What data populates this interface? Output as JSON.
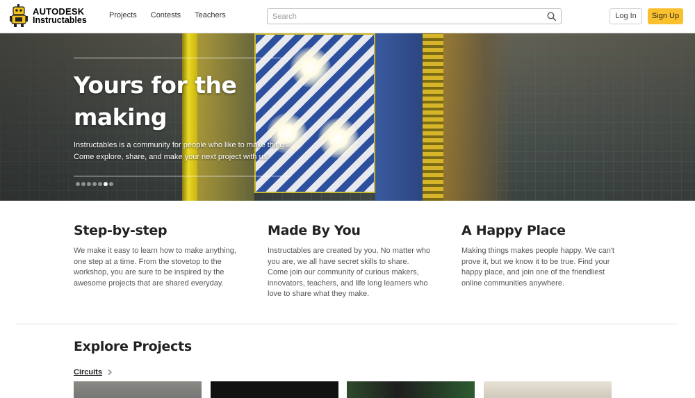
{
  "header": {
    "logo": {
      "brand": "AUTODESK",
      "product": "Instructables"
    },
    "nav": [
      "Projects",
      "Contests",
      "Teachers"
    ],
    "search": {
      "placeholder": "Search"
    },
    "login_label": "Log In",
    "signup_label": "Sign Up"
  },
  "hero": {
    "title": "Yours for the making",
    "description": "Instructables is a community for people who like to make things. Come explore, share, and make your next project with us!",
    "slides": {
      "count": 7,
      "active": 6
    }
  },
  "features": [
    {
      "title": "Step-by-step",
      "text": "We make it easy to learn how to make anything, one step at a time. From the stovetop to the workshop, you are sure to be inspired by the awesome projects that are shared everyday."
    },
    {
      "title": "Made By You",
      "text": "Instructables are created by you. No matter who you are, we all have secret skills to share. Come join our community of curious makers, innovators, teachers, and life long learners who love to share what they make."
    },
    {
      "title": "A Happy Place",
      "text": "Making things makes people happy. We can't prove it, but we know it to be true. Find your happy place, and join one of the friendliest online communities anywhere."
    }
  ],
  "explore": {
    "title": "Explore Projects",
    "category": "Circuits"
  },
  "colors": {
    "accent": "#fbc02d",
    "text": "#222222"
  }
}
